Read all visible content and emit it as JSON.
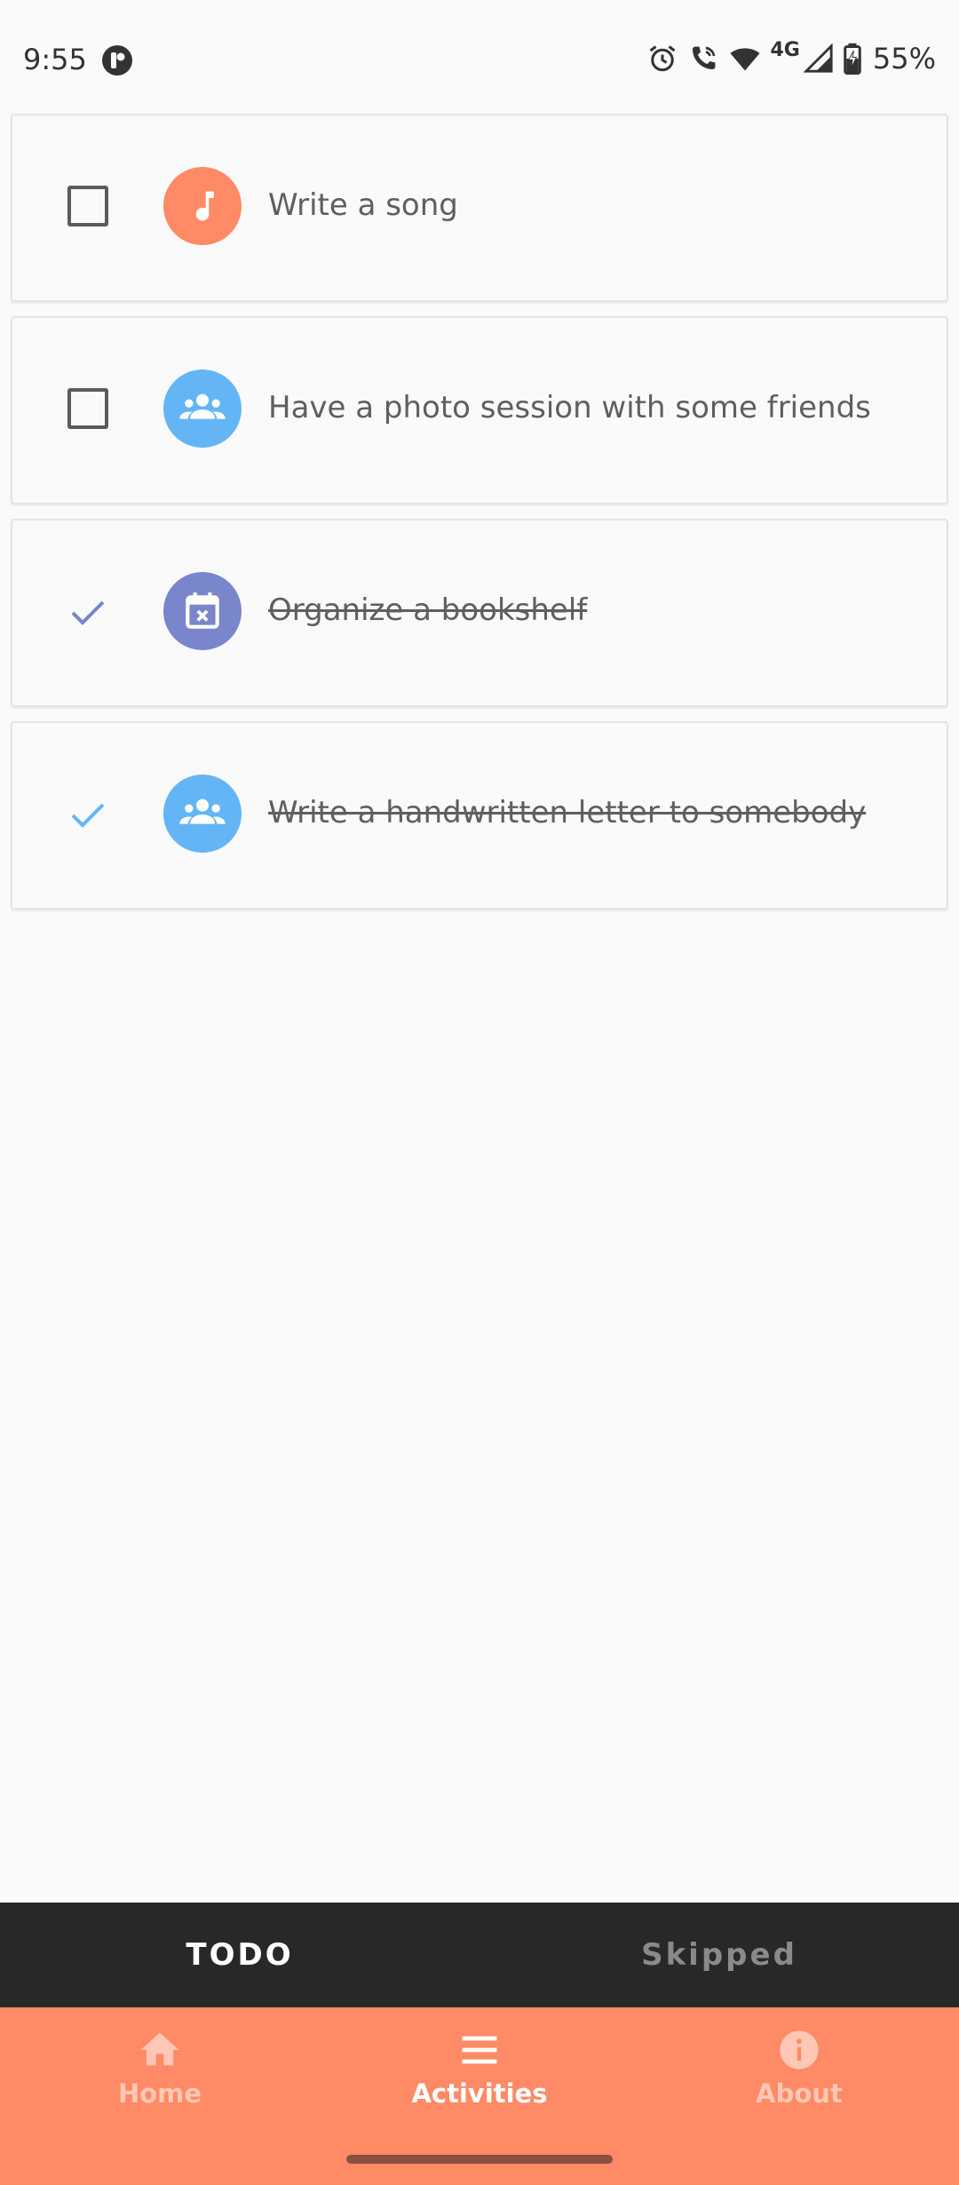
{
  "status_bar": {
    "time": "9:55",
    "network_label": "4G",
    "battery_percent": "55%"
  },
  "colors": {
    "accent": "#FF8A65",
    "blue": "#64B5F6",
    "indigo": "#7986CB",
    "tab_bar": "#282828"
  },
  "activities": [
    {
      "title": "Write a song",
      "done": false,
      "icon": "music-note-icon",
      "color": "#FF8A65"
    },
    {
      "title": "Have a photo session with some friends",
      "done": false,
      "icon": "group-icon",
      "color": "#64B5F6"
    },
    {
      "title": "Organize a bookshelf",
      "done": true,
      "icon": "calendar-x-icon",
      "color": "#7986CB"
    },
    {
      "title": "Write a handwritten letter to somebody",
      "done": true,
      "icon": "group-icon",
      "color": "#64B5F6"
    }
  ],
  "tabs": [
    {
      "label": "TODO",
      "active": true
    },
    {
      "label": "Skipped",
      "active": false
    }
  ],
  "bottom_nav": [
    {
      "label": "Home",
      "icon": "home-icon",
      "active": false
    },
    {
      "label": "Activities",
      "icon": "menu-icon",
      "active": true
    },
    {
      "label": "About",
      "icon": "info-icon",
      "active": false
    }
  ]
}
